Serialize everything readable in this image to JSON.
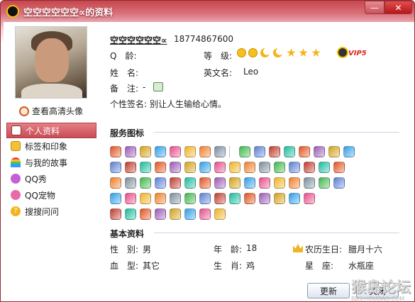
{
  "window": {
    "title": "空空空空空空∝的资料",
    "min_glyph": "—",
    "close_glyph": "✕"
  },
  "sidebar": {
    "hd_avatar_label": "查看高清头像",
    "items": [
      {
        "label": "个人资料",
        "icon": "profile-card-icon",
        "active": true
      },
      {
        "label": "标签和印象",
        "icon": "tag-icon",
        "active": false
      },
      {
        "label": "与我的故事",
        "icon": "rainbow-icon",
        "active": false
      },
      {
        "label": "QQ秀",
        "icon": "qq-show-icon",
        "active": false
      },
      {
        "label": "QQ宠物",
        "icon": "qq-pet-icon",
        "active": false
      },
      {
        "label": "搜搜问问",
        "icon": "question-icon",
        "active": false
      }
    ]
  },
  "profile": {
    "nickname": "空空空空空空∝",
    "qq_number": "18774867600",
    "qq_age_label": "Q　龄:",
    "qq_age_value": "",
    "level_label": "等　级:",
    "level_icons": [
      "sun",
      "sun",
      "moon",
      "moon",
      "star",
      "star",
      "star"
    ],
    "vip_badge": "VIP5",
    "name_label": "姓　名:",
    "name_value": "",
    "eng_name_label": "英文名:",
    "eng_name_value": "Leo",
    "note_label": "备　注:",
    "note_value": "-",
    "signature_label": "个性签名:",
    "signature_value": "别让人生输给心情。"
  },
  "services": {
    "title": "服务图标",
    "row_counts": [
      16,
      16,
      16,
      14,
      8
    ]
  },
  "basic_info": {
    "title": "基本资料",
    "gender_label": "性　别:",
    "gender_value": "男",
    "age_label": "年　龄:",
    "age_value": "18",
    "lunar_label": "农历生日:",
    "lunar_value": "腊月十六",
    "blood_label": "血　型:",
    "blood_value": "其它",
    "zodiac_label": "生　肖:",
    "zodiac_value": "鸡",
    "constellation_label": "星　座:",
    "constellation_value": "水瓶座"
  },
  "buttons": {
    "refresh": "更新",
    "close": "关闭"
  },
  "watermark": {
    "main": "猴岛论坛",
    "sub": "BBS.HOUDAO.COM"
  },
  "colors": {
    "accent": "#c84c55",
    "section_line": "#c9d6e6"
  }
}
